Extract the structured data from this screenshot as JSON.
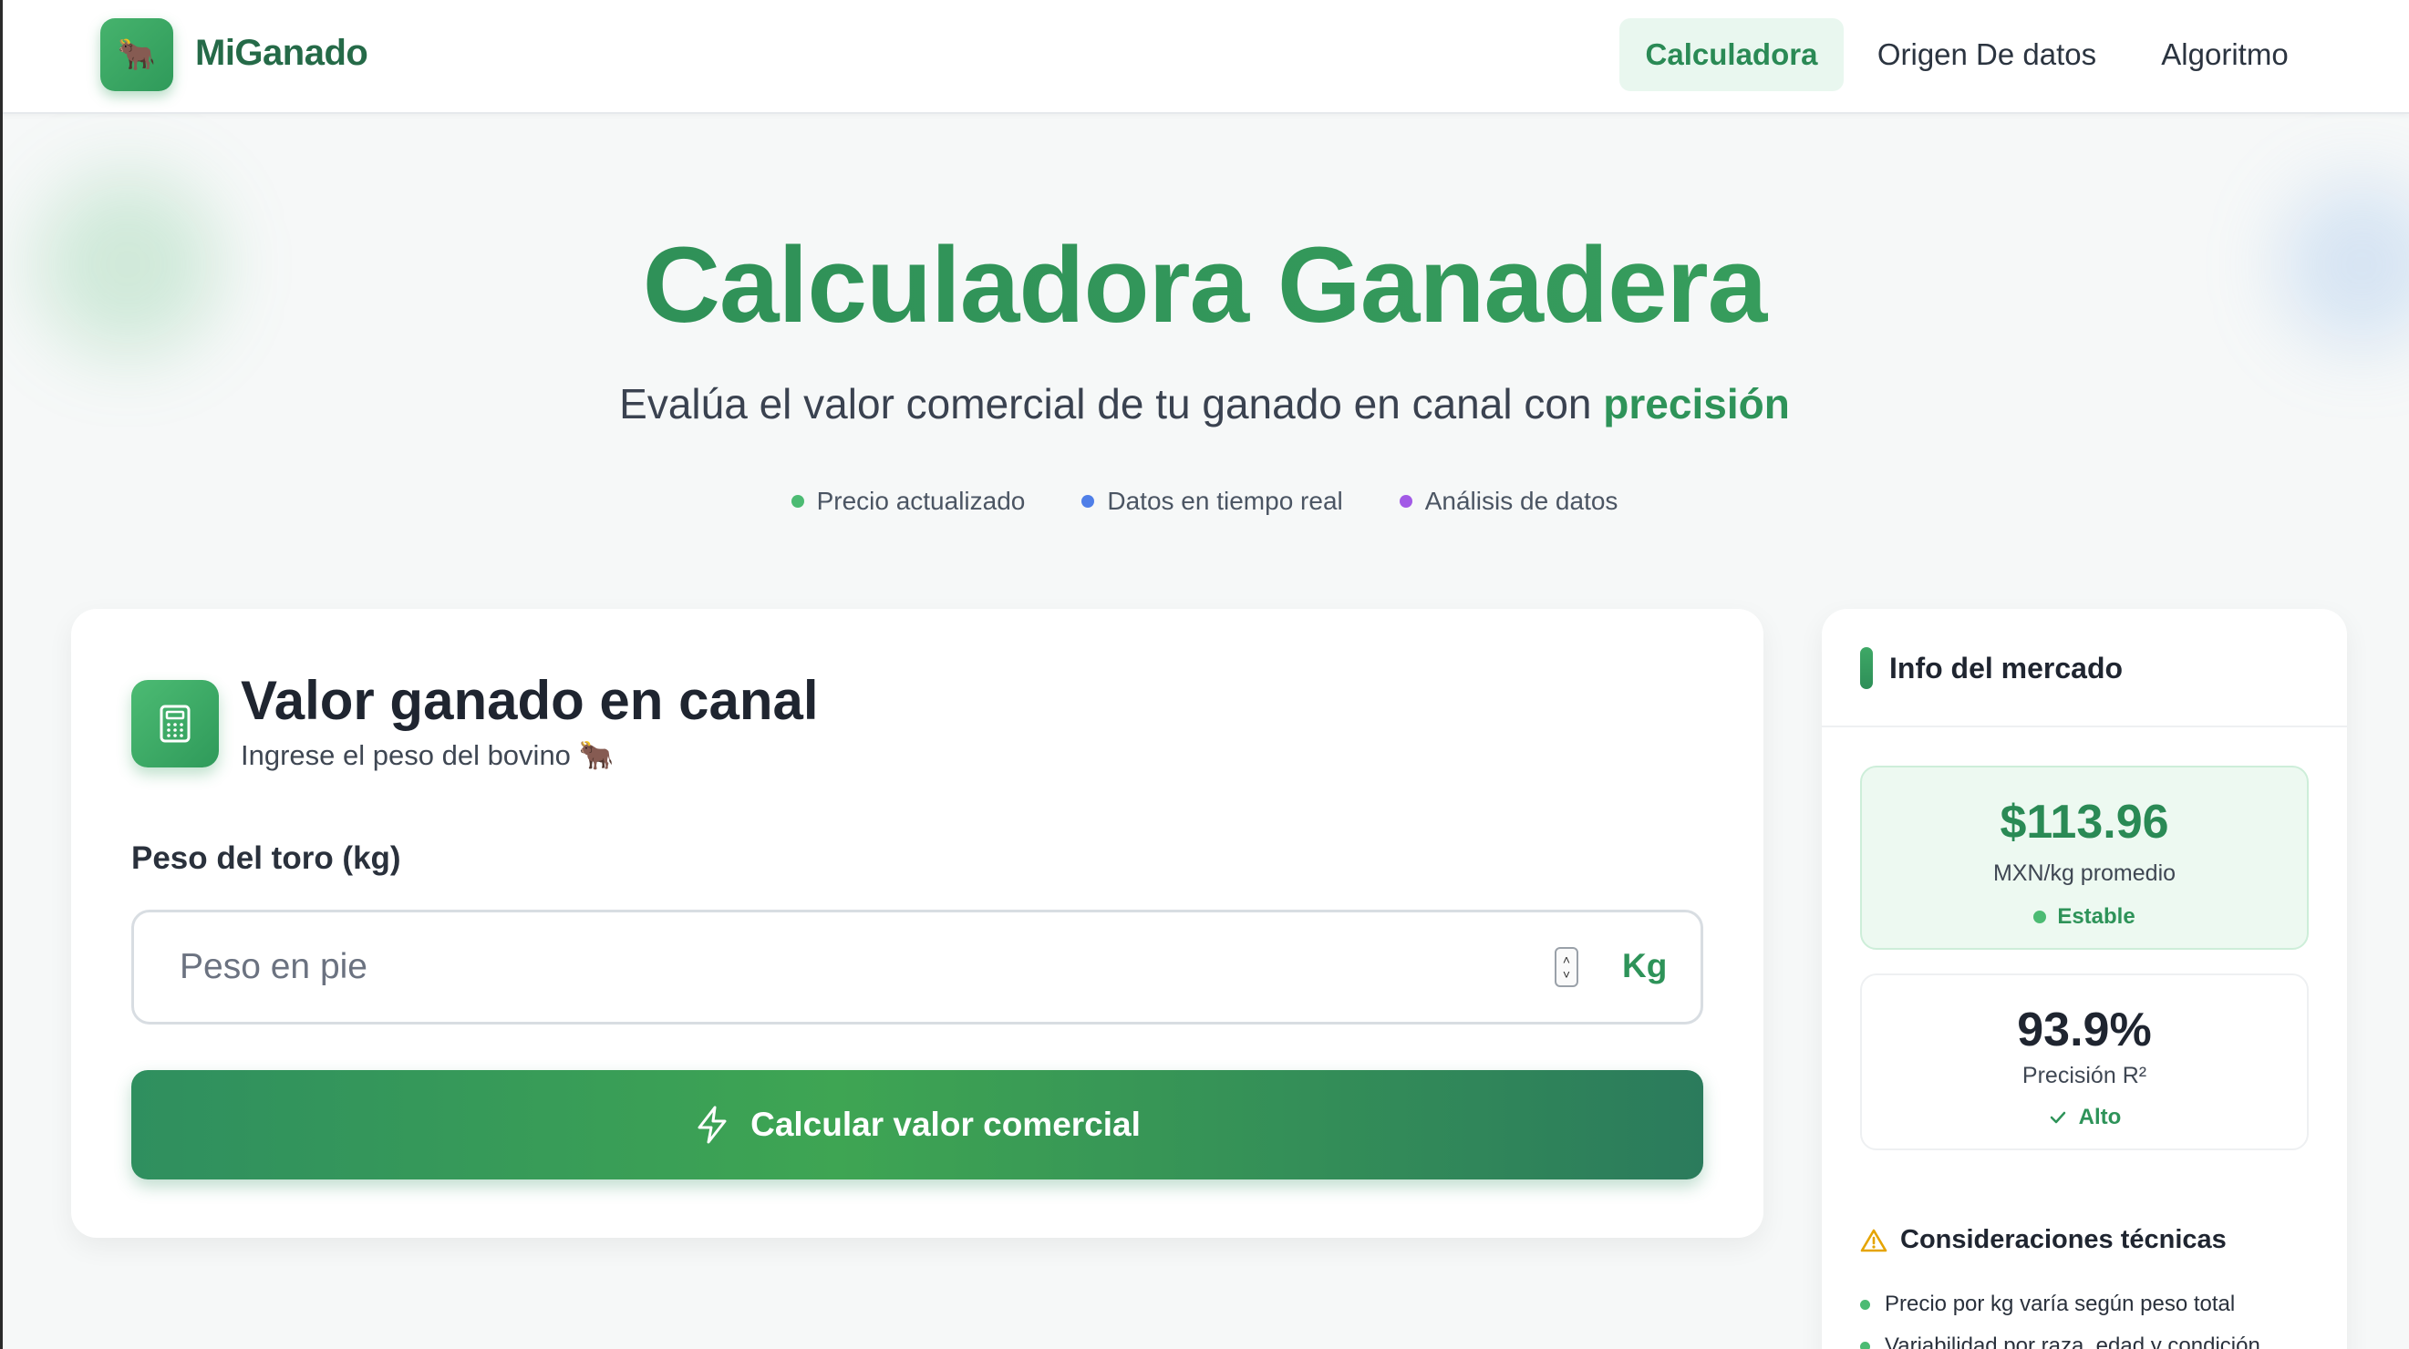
{
  "nav": {
    "logo_icon": "cow-icon",
    "brand": "MiGanado",
    "items": [
      {
        "label": "Calculadora",
        "active": true
      },
      {
        "label": "Origen De datos",
        "active": false
      },
      {
        "label": "Algoritmo",
        "active": false
      }
    ]
  },
  "hero": {
    "title": "Calculadora Ganadera",
    "subtitle_main": "Evalúa el valor comercial de tu ganado en canal con",
    "subtitle_accent": "precisión",
    "features": [
      {
        "label": "Precio actualizado",
        "color": "#4cbb73"
      },
      {
        "label": "Datos en tiempo real",
        "color": "#4f7fe8"
      },
      {
        "label": "Análisis de datos",
        "color": "#a25ae6"
      }
    ]
  },
  "calculator": {
    "icon": "calculator-icon",
    "title": "Valor ganado en canal",
    "subtitle": "Ingrese el peso del bovino 🐂",
    "field_label": "Peso del toro (kg)",
    "input_value": "",
    "input_placeholder": "Peso en pie",
    "unit": "Kg",
    "button_icon": "lightning-icon",
    "button_label": "Calcular valor comercial"
  },
  "market": {
    "title": "Info del mercado",
    "price": {
      "value": "$113.96",
      "label": "MXN/kg promedio",
      "status": "Estable"
    },
    "precision": {
      "value": "93.9%",
      "label": "Precisión R²",
      "status": "Alto"
    },
    "considerations_title": "Consideraciones técnicas",
    "considerations": [
      "Precio por kg varía según peso total",
      "Variabilidad por raza, edad y condición"
    ]
  },
  "colors": {
    "accent": "#2e9359",
    "button_gradient_start": "#2f8f5f",
    "button_gradient_mid": "#3ea553",
    "warning": "#e5a400"
  }
}
